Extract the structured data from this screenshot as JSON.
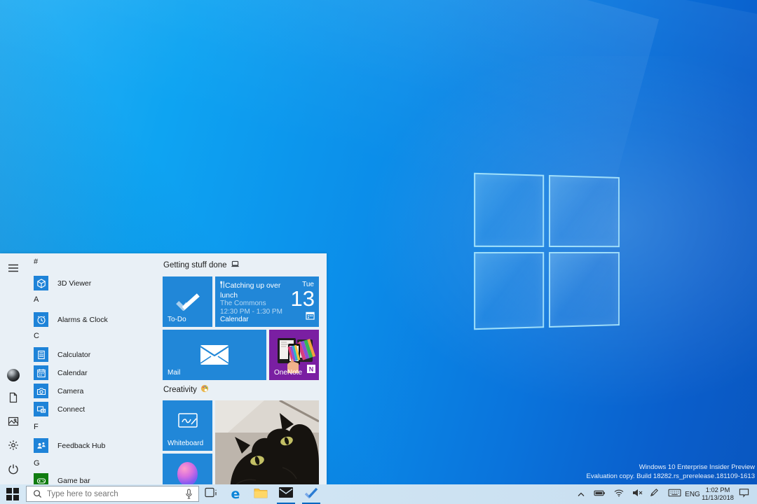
{
  "colors": {
    "tile_blue": "#2187d8",
    "accent_blue": "#0067c0",
    "onenote_purple": "#7a1fa2",
    "gamebar_green": "#107c10",
    "menu_bg": "#e9f0f6",
    "taskbar_bg": "#cfe3f1"
  },
  "watermark": {
    "line1": "Windows 10 Enterprise Insider Preview",
    "line2": "Evaluation copy. Build 18282.rs_prerelease.181109-1613"
  },
  "start_menu": {
    "sections": [
      {
        "letter": "#"
      },
      {
        "letter": "A"
      },
      {
        "letter": "C"
      },
      {
        "letter": "F"
      },
      {
        "letter": "G"
      }
    ],
    "apps": [
      {
        "label": "3D Viewer"
      },
      {
        "label": "Alarms & Clock"
      },
      {
        "label": "Calculator"
      },
      {
        "label": "Calendar"
      },
      {
        "label": "Camera"
      },
      {
        "label": "Connect"
      },
      {
        "label": "Feedback Hub"
      },
      {
        "label": "Game bar"
      }
    ],
    "groups": [
      {
        "title": "Getting stuff done"
      },
      {
        "title": "Creativity"
      }
    ],
    "tiles": {
      "todo": {
        "label": "To-Do"
      },
      "calendar": {
        "label": "Calendar",
        "day_name": "Tue",
        "day_number": "13",
        "event_title": "Catching up over lunch",
        "event_location": "The Commons",
        "event_time": "12:30 PM - 1:30 PM"
      },
      "mail": {
        "label": "Mail"
      },
      "onenote": {
        "label": "OneNote"
      },
      "whiteboard": {
        "label": "Whiteboard"
      }
    }
  },
  "taskbar": {
    "search_placeholder": "Type here to search",
    "tray": {
      "language": "ENG",
      "time": "1:02 PM",
      "date": "11/13/2018"
    }
  }
}
